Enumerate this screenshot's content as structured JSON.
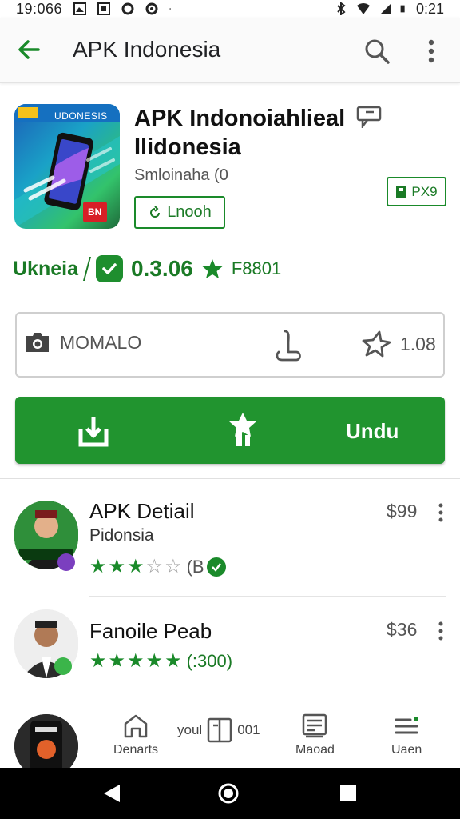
{
  "status_bar": {
    "time": "19:066",
    "right_time": "0:21"
  },
  "app_bar": {
    "title": "APK Indonesia"
  },
  "app": {
    "icon_text": "UDONESIS",
    "icon_badge": "BN",
    "title": "APK Indonoiahlieal Ilidonesia",
    "subtitle": "Smloinaha (0",
    "install_tag": "Lnooh",
    "size_tag": "PX9"
  },
  "rating_row": {
    "label": "Ukneia",
    "version": "0.3.06",
    "extra": "F8801"
  },
  "info_card": {
    "left_label": "MOMALO",
    "rating": "1.08"
  },
  "download_button": {
    "label": "Undu"
  },
  "list": [
    {
      "title": "APK Detiail",
      "subtitle": "Pidonsia",
      "stars_filled": 2.5,
      "count": "(B",
      "price": "$99"
    },
    {
      "title": "Fanoile Peab",
      "subtitle": "",
      "stars_filled": 5,
      "count": "(:300)",
      "price": "$36"
    }
  ],
  "bottom_nav": {
    "items": [
      {
        "label": "Denarts"
      },
      {
        "label": "Maoad"
      },
      {
        "label": "Uaen"
      }
    ],
    "mid_left": "youl",
    "mid_right": "001"
  },
  "colors": {
    "accent": "#21942f",
    "accent_dark": "#1a7a25",
    "system_nav": "#000000"
  }
}
